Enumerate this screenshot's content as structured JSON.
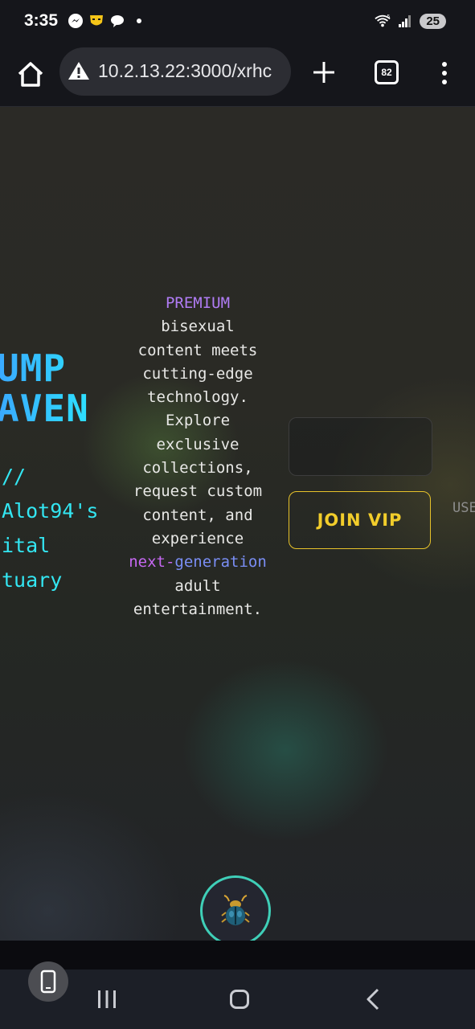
{
  "status_bar": {
    "time": "3:35",
    "notification_icons": [
      "messenger-icon",
      "grindr-icon",
      "chat-icon"
    ],
    "wifi_label": "5",
    "battery": "25"
  },
  "browser": {
    "url": "10.2.13.22:3000/xrhc",
    "tab_count": "82",
    "icons": [
      "home-icon",
      "warning-icon",
      "plus-icon",
      "tabs-icon",
      "menu-dots-icon"
    ]
  },
  "hero": {
    "title_line1": "UMP",
    "title_line2": "AVEN",
    "sub_line1": "//",
    "sub_line2": "Alot94's",
    "sub_line3": "ital",
    "sub_line4": "tuary"
  },
  "description": {
    "premium": "PREMIUM",
    "part1": "bisexual content meets cutting-edge technology. Explore exclusive collections, request custom content, and experience",
    "next": "next-",
    "generation": "generation",
    "part2": "adult entertainment."
  },
  "vip": {
    "join_label": "JOIN VIP",
    "side_text": "USE"
  },
  "colors": {
    "accent_cyan": "#33e6f2",
    "accent_blue": "#3aa8ff",
    "accent_gold": "#f2cd2b",
    "accent_purple": "#b07cf5",
    "fab_ring": "#3fcfb8"
  }
}
